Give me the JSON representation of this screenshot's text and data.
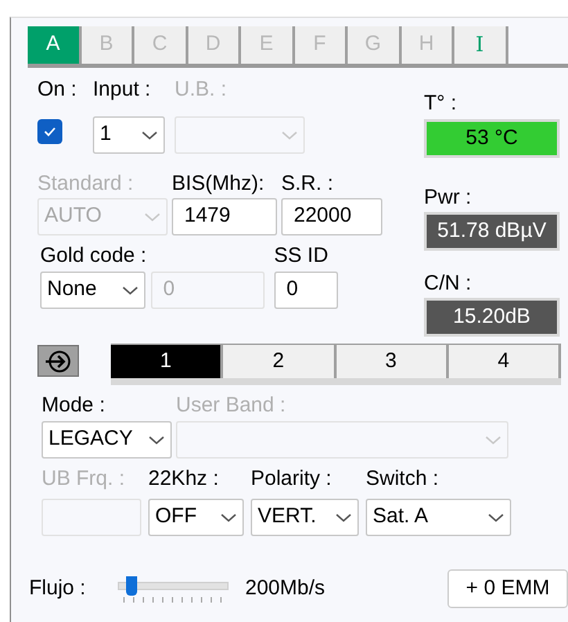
{
  "tabs": [
    {
      "label": "A",
      "selected": true,
      "disabled": false
    },
    {
      "label": "B",
      "selected": false,
      "disabled": true
    },
    {
      "label": "C",
      "selected": false,
      "disabled": true
    },
    {
      "label": "D",
      "selected": false,
      "disabled": true
    },
    {
      "label": "E",
      "selected": false,
      "disabled": true
    },
    {
      "label": "F",
      "selected": false,
      "disabled": true
    },
    {
      "label": "G",
      "selected": false,
      "disabled": true
    },
    {
      "label": "H",
      "selected": false,
      "disabled": true
    },
    {
      "label": "I",
      "selected": false,
      "disabled": false
    }
  ],
  "on": {
    "label": "On :",
    "checked": true
  },
  "input": {
    "label": "Input :",
    "kind": "select",
    "value": "1",
    "disabled": false
  },
  "ub": {
    "label": "U.B. :",
    "kind": "select",
    "disabled": true
  },
  "standard": {
    "label": "Standard :",
    "kind": "select",
    "value": "AUTO",
    "disabled": true
  },
  "bis": {
    "label": "BIS(Mhz):",
    "kind": "text",
    "value": "1479",
    "disabled": false
  },
  "sr": {
    "label": "S.R. :",
    "kind": "text",
    "value": "22000",
    "disabled": false
  },
  "gold_code": {
    "label": "Gold code :",
    "kind": "select",
    "value": "None",
    "disabled": false
  },
  "gold_code_value": {
    "kind": "text",
    "value": "0",
    "disabled": true
  },
  "ss_id": {
    "label": "SS ID",
    "kind": "text",
    "value": "0",
    "disabled": false
  },
  "temperature": {
    "label": "T° :",
    "value": "53 °C"
  },
  "power": {
    "label": "Pwr :",
    "value": "51.78 dBµV"
  },
  "cn": {
    "label": "C/N :",
    "value": "15.20dB"
  },
  "ports": [
    {
      "label": "1",
      "selected": true
    },
    {
      "label": "2",
      "selected": false
    },
    {
      "label": "3",
      "selected": false
    },
    {
      "label": "4",
      "selected": false
    }
  ],
  "mode": {
    "label": "Mode :",
    "kind": "select",
    "value": "LEGACY",
    "disabled": false
  },
  "user_band": {
    "label": "User Band :",
    "kind": "select",
    "disabled": true
  },
  "ub_frq": {
    "label": "UB Frq. :",
    "kind": "text",
    "disabled": true
  },
  "khz22": {
    "label": "22Khz :",
    "kind": "select",
    "value": "OFF",
    "disabled": false
  },
  "polarity": {
    "label": "Polarity :",
    "kind": "select",
    "value": "VERT.",
    "disabled": false
  },
  "switch": {
    "label": "Switch :",
    "kind": "select",
    "value": "Sat. A",
    "disabled": false
  },
  "flujo": {
    "label": "Flujo :",
    "level": 0.05,
    "reading": "200Mb/s"
  },
  "emm_button": "+ 0 EMM"
}
